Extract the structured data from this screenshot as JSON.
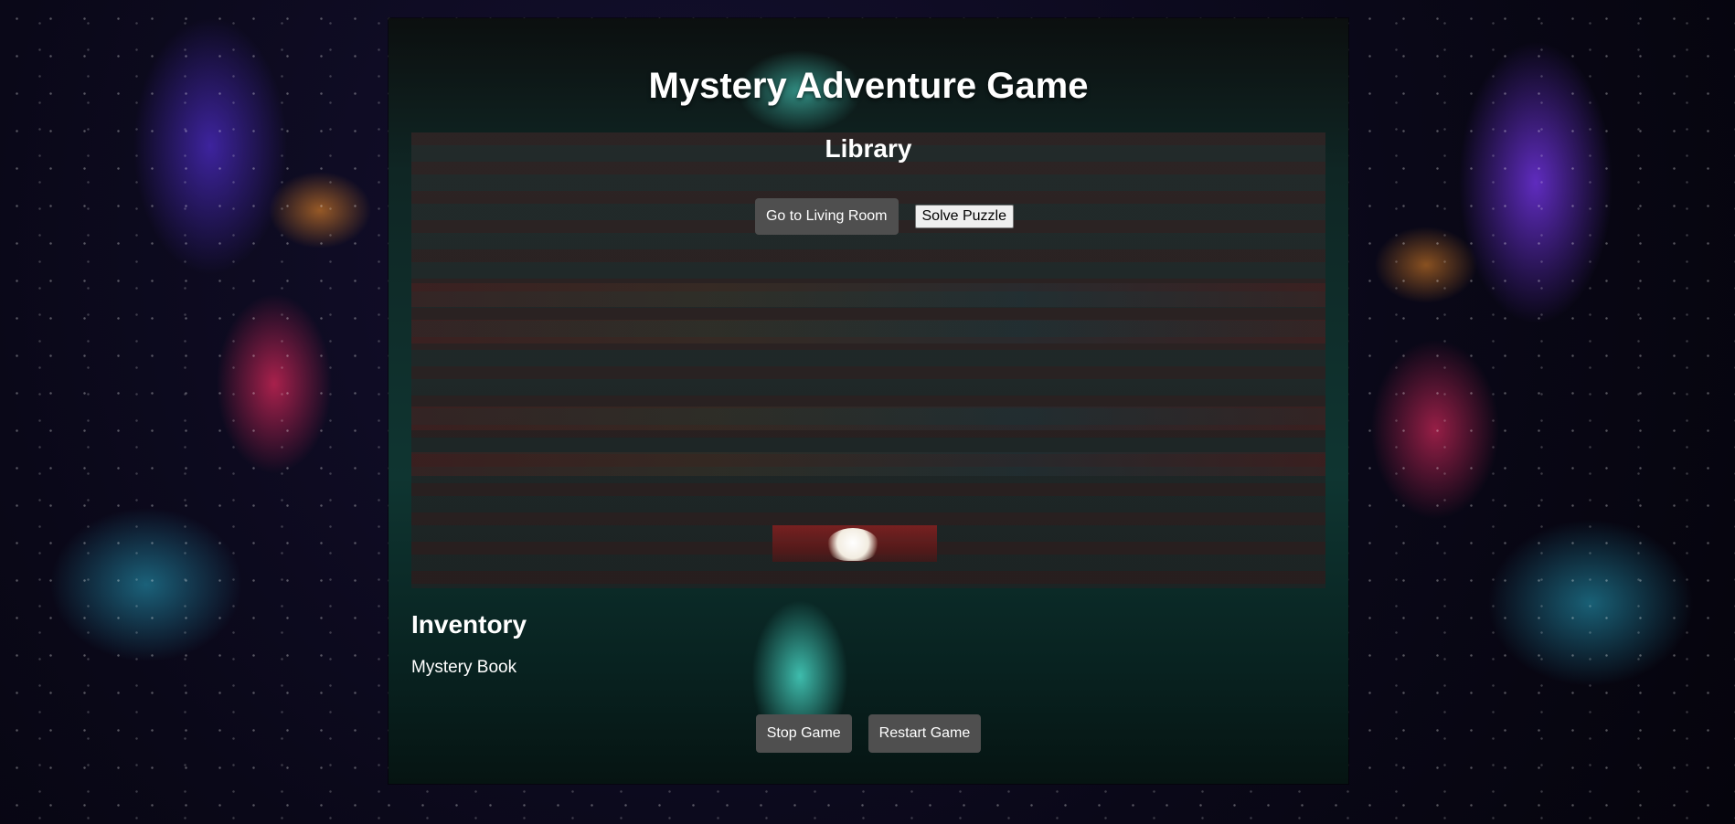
{
  "game": {
    "title": "Mystery Adventure Game"
  },
  "room": {
    "name": "Library",
    "actions": {
      "go_living_room": "Go to Living Room",
      "solve_puzzle": "Solve Puzzle"
    }
  },
  "inventory": {
    "heading": "Inventory",
    "items": [
      "Mystery Book"
    ]
  },
  "controls": {
    "stop": "Stop Game",
    "restart": "Restart Game"
  }
}
